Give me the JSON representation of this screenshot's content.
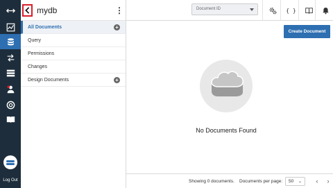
{
  "rail": {
    "logout_label": "Log Out",
    "active_color": "#2d6fb1",
    "bg_color": "#1d2d3b"
  },
  "sidebar": {
    "db_name": "mydb",
    "items": [
      {
        "label": "All Documents",
        "has_add": true,
        "active": true
      },
      {
        "label": "Query",
        "has_add": false
      },
      {
        "label": "Permissions",
        "has_add": false
      },
      {
        "label": "Changes",
        "has_add": false
      },
      {
        "label": "Design Documents",
        "has_add": true
      }
    ]
  },
  "toolbar": {
    "document_id_placeholder": "Document ID",
    "json_label": "{ }"
  },
  "main": {
    "create_button": "Create Document",
    "empty_message": "No Documents Found"
  },
  "footer": {
    "showing_text": "Showing 0 documents.",
    "per_page_label": "Documents per page:",
    "per_page_value": "50"
  }
}
